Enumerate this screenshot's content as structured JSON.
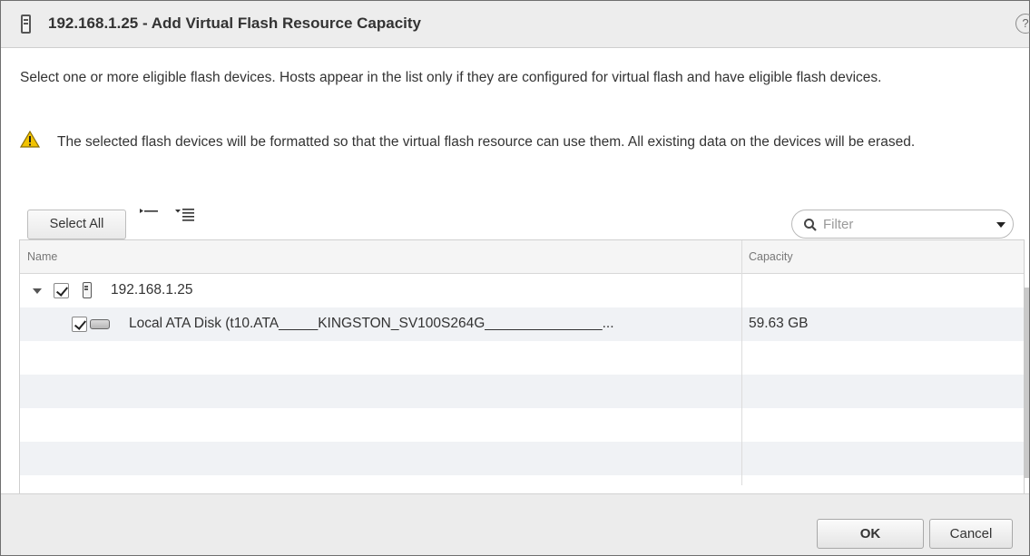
{
  "dialog": {
    "title": "192.168.1.25 - Add Virtual Flash Resource Capacity",
    "help_label": "?"
  },
  "content": {
    "description": "Select one or more eligible flash devices. Hosts appear in the list only if they are configured for virtual flash and have eligible flash devices.",
    "warning": "The selected flash devices will be formatted so that the virtual flash resource can use them. All existing data on the devices will be erased.",
    "warning_color": "#f2c300"
  },
  "toolbar": {
    "select_all_label": "Select All",
    "filter_placeholder": "Filter",
    "icons": [
      "collapse-all-icon",
      "expand-all-icon"
    ]
  },
  "table": {
    "columns": [
      "Name",
      "Capacity"
    ],
    "rows": [
      {
        "name": "192.168.1.25",
        "checked": true,
        "expanded": true,
        "icon": "host-icon",
        "capacity": ""
      },
      {
        "name": "Local ATA Disk (t10.ATA_____KINGSTON_SV100S264G_______________...",
        "checked": true,
        "icon": "disk-icon",
        "capacity": "59.63 GB"
      }
    ]
  },
  "footer": {
    "ok_label": "OK",
    "cancel_label": "Cancel"
  },
  "colors": {
    "title_bar": "#ededed",
    "row_alt": "#f0f2f5"
  }
}
